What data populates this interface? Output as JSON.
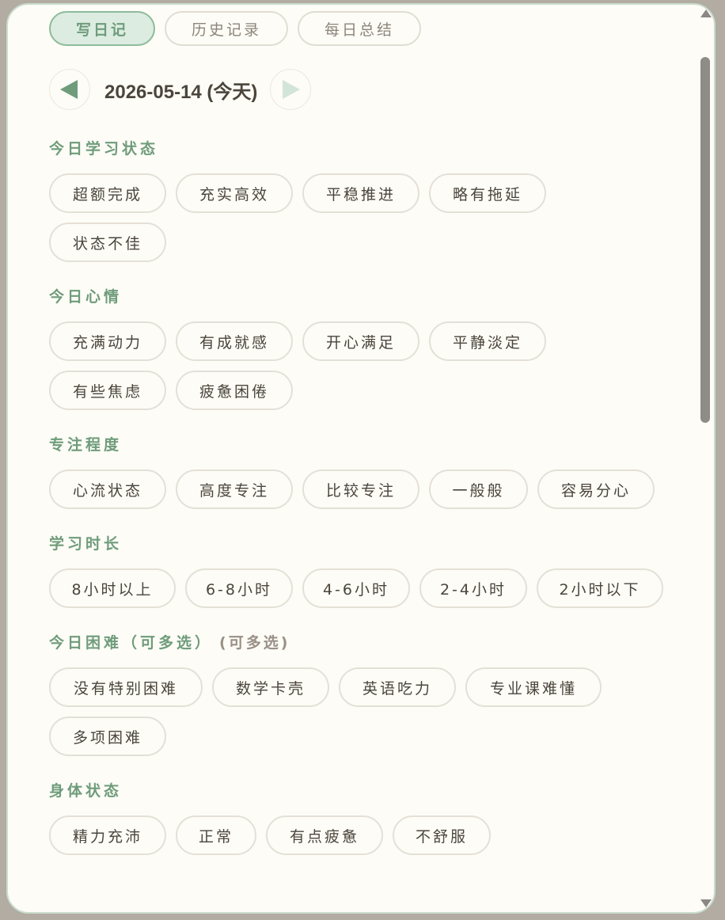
{
  "tabs": [
    {
      "label": "写日记",
      "active": true
    },
    {
      "label": "历史记录",
      "active": false
    },
    {
      "label": "每日总结",
      "active": false
    }
  ],
  "date": {
    "text": "2026-05-14 (今天)"
  },
  "icons": {
    "prev": "triangle-left-icon",
    "next": "triangle-right-icon"
  },
  "colors": {
    "accent": "#6f9c7b",
    "background": "#fdfcf6",
    "chip_border": "#e5e0d7",
    "text": "#4b453c"
  },
  "sections": [
    {
      "title": "今日学习状态",
      "options": [
        "超额完成",
        "充实高效",
        "平稳推进",
        "略有拖延",
        "状态不佳"
      ]
    },
    {
      "title": "今日心情",
      "options": [
        "充满动力",
        "有成就感",
        "开心满足",
        "平静淡定",
        "有些焦虑",
        "疲惫困倦"
      ]
    },
    {
      "title": "专注程度",
      "options": [
        "心流状态",
        "高度专注",
        "比较专注",
        "一般般",
        "容易分心"
      ]
    },
    {
      "title": "学习时长",
      "options": [
        "8小时以上",
        "6-8小时",
        "4-6小时",
        "2-4小时",
        "2小时以下"
      ]
    },
    {
      "title": "今日困难（可多选）",
      "hint": "(可多选)",
      "options": [
        "没有特别困难",
        "数学卡壳",
        "英语吃力",
        "专业课难懂",
        "多项困难"
      ]
    },
    {
      "title": "身体状态",
      "options": [
        "精力充沛",
        "正常",
        "有点疲惫",
        "不舒服"
      ]
    }
  ]
}
